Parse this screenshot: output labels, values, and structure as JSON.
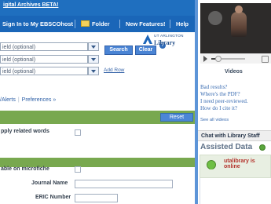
{
  "top": {
    "beta_text": "igital Archives BETA!"
  },
  "nav": {
    "signin": "Sign In to My EBSCOhost",
    "folder": "Folder",
    "new_features": "New Features!",
    "help": "Help"
  },
  "search": {
    "fields": [
      "ield (optional)",
      "ield (optional)",
      "ield (optional)"
    ],
    "search_button": "Search",
    "clear_button": "Clear",
    "add_row": "Add Row"
  },
  "logo": {
    "line1": "UT ARLINGTON",
    "line2": "Library"
  },
  "links": {
    "alerts": "/Alerts",
    "preferences": "Preferences »"
  },
  "reset": "Reset",
  "left_labels": {
    "apply_related_words": "pply related words",
    "available_on_microfiche": "able on microfiche",
    "journal_name": "Journal Name",
    "eric_number": "ERIC Number"
  },
  "videos": {
    "title": "Videos",
    "links": "Bad results?\nWhere's the PDF?\nI need peer-reviewed.\nHow do I cite it?",
    "see_all": "See all videos"
  },
  "chat": {
    "title": "Chat with Library Staff",
    "assisted_title": "Assisted Data",
    "status_line1": "utalibrary is",
    "status_line2": "online"
  },
  "colors": {
    "background": "#2c7fd4",
    "panel": "#ffffff",
    "nav": "#1a66b8",
    "section": "#78a84f"
  }
}
